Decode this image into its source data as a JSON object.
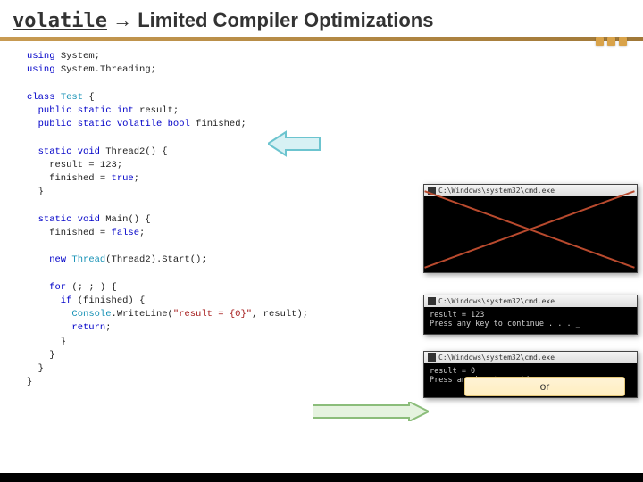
{
  "title": {
    "keyword": "volatile",
    "arrow": "→",
    "rest": "Limited Compiler Optimizations"
  },
  "code": {
    "l1a": "using",
    "l1b": " System;",
    "l2a": "using",
    "l2b": " System.Threading;",
    "l3a": "class",
    "l3b": " ",
    "l3c": "Test",
    "l3d": " {",
    "l4a": "  public",
    "l4b": " ",
    "l4c": "static",
    "l4d": " ",
    "l4e": "int",
    "l4f": " result;",
    "l5a": "  public",
    "l5b": " ",
    "l5c": "static",
    "l5d": " ",
    "l5e": "volatile",
    "l5f": " ",
    "l5g": "bool",
    "l5h": " finished;",
    "l6a": "  static",
    "l6b": " ",
    "l6c": "void",
    "l6d": " Thread2() {",
    "l7": "    result = 123;",
    "l8a": "    finished = ",
    "l8b": "true",
    "l8c": ";",
    "l9": "  }",
    "l10a": "  static",
    "l10b": " ",
    "l10c": "void",
    "l10d": " Main() {",
    "l11a": "    finished = ",
    "l11b": "false",
    "l11c": ";",
    "l12a": "    new",
    "l12b": " ",
    "l12c": "Thread",
    "l12d": "(Thread2).Start();",
    "l13a": "    for",
    "l13b": " (; ; ) {",
    "l14a": "      if",
    "l14b": " (finished) {",
    "l15a": "        ",
    "l15b": "Console",
    "l15c": ".WriteLine(",
    "l15d": "\"result = {0}\"",
    "l15e": ", result);",
    "l16a": "        return",
    "l16b": ";",
    "l17": "      }",
    "l18": "    }",
    "l19": "  }",
    "l20": "}"
  },
  "console_title": "C:\\Windows\\system32\\cmd.exe",
  "con2": {
    "line1": "result = 123",
    "line2": "Press any key to continue . . . _"
  },
  "con3": {
    "line1": "result = 0",
    "line2": "Press any key to continue . . ."
  },
  "or_label": "or",
  "colors": {
    "accent": "#c89b52",
    "arrow_cyan": "#8fd9e0",
    "arrow_green": "#9fcf8f",
    "cross": "#b94a2e"
  }
}
